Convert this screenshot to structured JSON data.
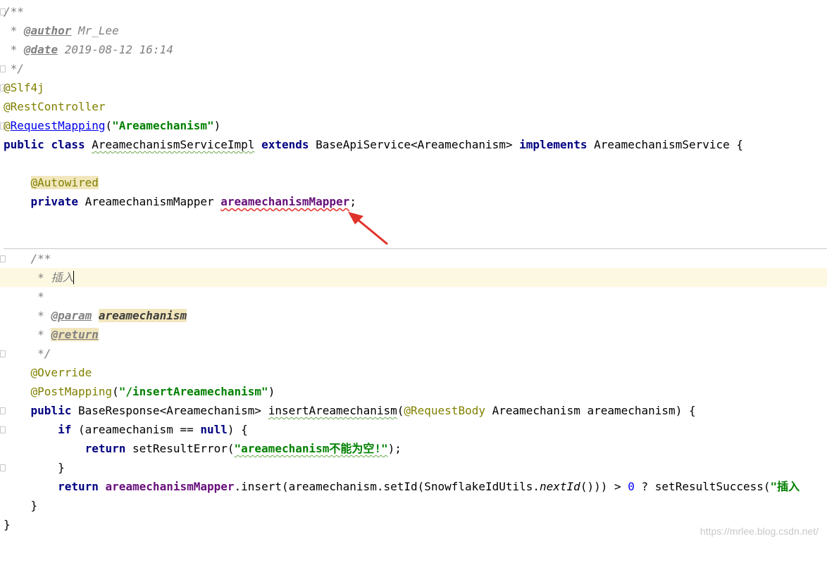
{
  "code": {
    "doc_open": "/**",
    "author_prefix": " * ",
    "author_tag": "@author",
    "author_value": " Mr_Lee",
    "date_prefix": " * ",
    "date_tag": "@date",
    "date_value": " 2019-08-12 16:14",
    "doc_close": " */",
    "anno_slf4j": "@Slf4j",
    "anno_restcontroller": "@RestController",
    "anno_at": "@",
    "anno_requestmapping": "RequestMapping",
    "paren_open": "(",
    "requestmapping_value": "\"Areamechanism\"",
    "paren_close": ")",
    "kw_public": "public",
    "kw_class": "class",
    "class_name": "AreamechanismServiceImpl",
    "kw_extends": "extends",
    "base_class": "BaseApiService<Areamechanism>",
    "kw_implements": "implements",
    "interface_name": "AreamechanismService",
    "brace_open": " {",
    "anno_autowired": "@Autowired",
    "kw_private": "private",
    "field_type": "AreamechanismMapper",
    "field_name": "areamechanismMapper",
    "semicolon": ";",
    "method_doc_open": "/**",
    "method_doc_insert_prefix": " * ",
    "method_doc_insert_text": "插入",
    "method_doc_blank": " *",
    "method_doc_param_prefix": " * ",
    "method_doc_param_tag": "@param",
    "method_doc_param_name": "areamechanism",
    "method_doc_return_prefix": " * ",
    "method_doc_return_tag": "@return",
    "method_doc_close": " */",
    "anno_override": "@Override",
    "anno_postmapping": "@PostMapping",
    "postmapping_value": "\"/insertAreamechanism\"",
    "method_return_type": "BaseResponse<Areamechanism>",
    "method_name": "insertAreamechanism",
    "anno_requestbody": "@RequestBody",
    "param_decl": " Areamechanism areamechanism) {",
    "kw_if": "if",
    "if_cond": " (areamechanism == ",
    "kw_null": "null",
    "if_close": ") {",
    "kw_return": "return",
    "set_error_call": " setResultError(",
    "error_message": "\"areamechanism不能为空!\"",
    "set_error_close": ");",
    "brace_close": "}",
    "return_insert_call": ".insert(areamechanism.setId(SnowflakeIdUtils.",
    "next_id": "nextId",
    "return_insert_mid": "())) > ",
    "zero": "0",
    "ternary": " ? setResultSuccess(",
    "success_message": "\"插入"
  },
  "watermark": "https://mrlee.blog.csdn.net/",
  "colors": {
    "keyword": "#000080",
    "string": "#008000",
    "annotation": "#808000",
    "comment": "#808080",
    "field": "#660e7a",
    "number": "#0000ff",
    "annotation_arrow": "#e0332b"
  }
}
